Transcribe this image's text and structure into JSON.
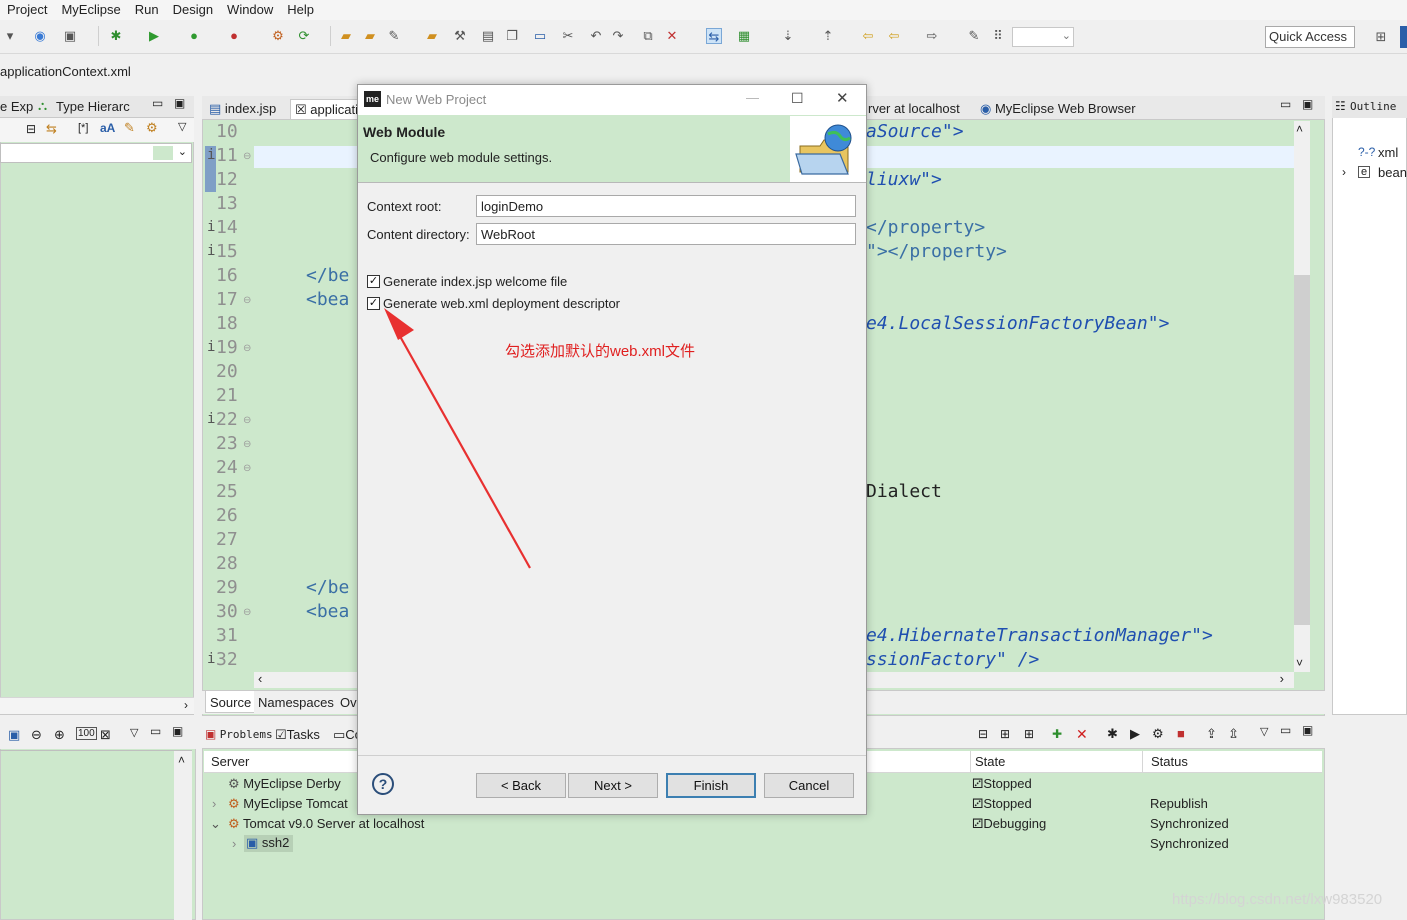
{
  "menu": [
    "Project",
    "MyEclipse",
    "Run",
    "Design",
    "Window",
    "Help"
  ],
  "toolbar": {
    "quick_access": "Quick Access"
  },
  "editor_title": "applicationContext.xml",
  "left_tabs": {
    "explorer": "e Exp",
    "type_hierarchy": "Type Hierarc"
  },
  "editor_tabs": [
    "index.jsp",
    "applicati",
    "rver at localhost",
    "MyEclipse Web Browser"
  ],
  "line_numbers": [
    "10",
    "11",
    "12",
    "13",
    "14",
    "15",
    "16",
    "17",
    "18",
    "19",
    "20",
    "21",
    "22",
    "23",
    "24",
    "25",
    "26",
    "27",
    "28",
    "29",
    "30",
    "31",
    "32"
  ],
  "code_visible": {
    "l10": "aSource\">",
    "l12": "liuxw\">",
    "l14": "</property>",
    "l15": "\"></property>",
    "l16": "</be",
    "l17": "<bea",
    "l18": "e4.LocalSessionFactoryBean\">",
    "l25": "Dialect",
    "l29": "</be",
    "l30": "<bea",
    "l31": "e4.HibernateTransactionManager\">",
    "l32": "ssionFactory\" />"
  },
  "source_tabs": [
    "Source",
    "Namespaces",
    "Ov"
  ],
  "outline": {
    "tab": "Outline",
    "items": [
      "xml",
      "bean"
    ]
  },
  "servers_tabs": [
    "Problems",
    "Tasks",
    "Co"
  ],
  "servers_table": {
    "headers": [
      "Server",
      "State",
      "Status"
    ],
    "rows": [
      {
        "name": "MyEclipse Derby",
        "state": "Stopped",
        "status": ""
      },
      {
        "name": "MyEclipse Tomcat",
        "state": "Stopped",
        "status": "Republish"
      },
      {
        "name": "Tomcat v9.0 Server at localhost",
        "state": "Debugging",
        "status": "Synchronized"
      },
      {
        "name": "ssh2",
        "state": "",
        "status": "Synchronized"
      }
    ]
  },
  "dialog": {
    "title": "New Web Project",
    "logo": "me",
    "header_title": "Web Module",
    "header_desc": "Configure web module settings.",
    "context_root_label": "Context root:",
    "context_root_value": "loginDemo",
    "content_dir_label": "Content directory:",
    "content_dir_value": "WebRoot",
    "generate_index_label": "Generate index.jsp welcome file",
    "generate_index_checked": true,
    "generate_webxml_label": "Generate web.xml deployment descriptor",
    "generate_webxml_checked": true,
    "buttons": {
      "help": "?",
      "back": "< Back",
      "next": "Next >",
      "finish": "Finish",
      "cancel": "Cancel"
    }
  },
  "annotation": "勾选添加默认的web.xml文件",
  "watermark": "https://blog.csdn.net/lxw983520",
  "colors": {
    "editor_bg": "#cde8cc",
    "accent": "#3c7fb1",
    "annotation": "#e02020"
  }
}
